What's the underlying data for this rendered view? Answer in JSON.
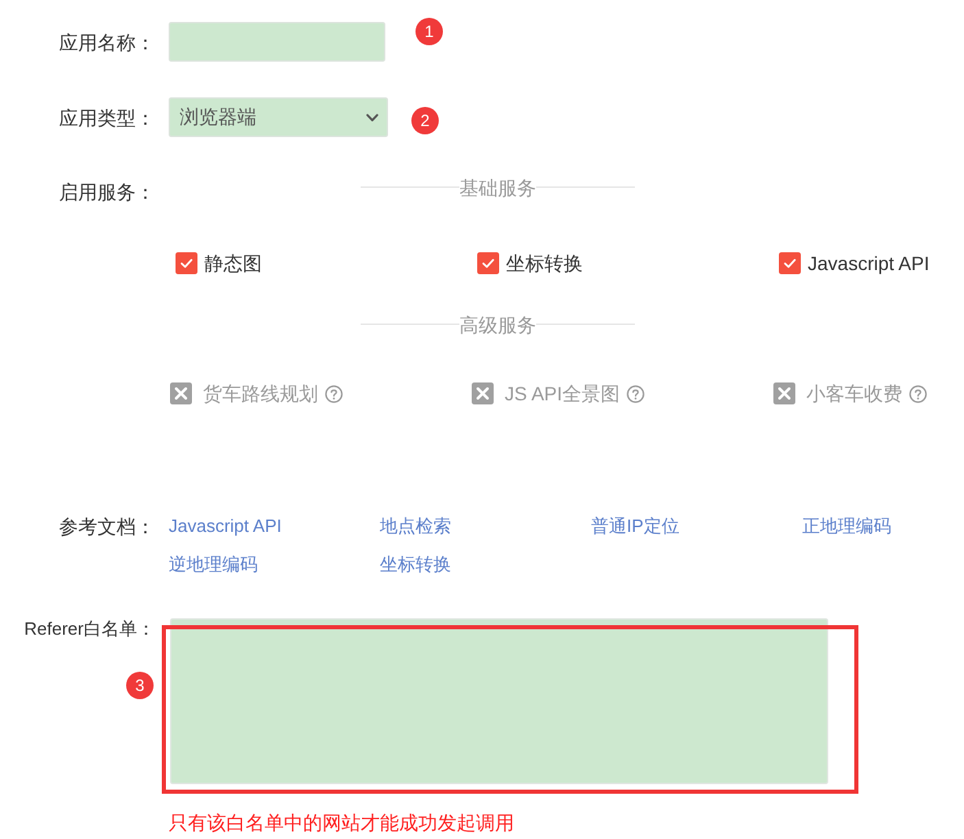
{
  "app_name": {
    "label": "应用名称：",
    "badge": "1"
  },
  "app_type": {
    "label": "应用类型：",
    "value": "浏览器端",
    "badge": "2"
  },
  "services": {
    "label": "启用服务：",
    "groups": [
      {
        "title": "基础服务",
        "items": [
          {
            "label": "静态图",
            "checked": true,
            "disabled": false,
            "help": false
          },
          {
            "label": "坐标转换",
            "checked": true,
            "disabled": false,
            "help": false
          },
          {
            "label": "Javascript API",
            "checked": true,
            "disabled": false,
            "help": false
          }
        ]
      },
      {
        "title": "高级服务",
        "items": [
          {
            "label": "货车路线规划",
            "checked": false,
            "disabled": true,
            "help": true
          },
          {
            "label": "JS API全景图",
            "checked": false,
            "disabled": true,
            "help": true
          },
          {
            "label": "小客车收费",
            "checked": false,
            "disabled": true,
            "help": true
          }
        ]
      }
    ]
  },
  "docs": {
    "label": "参考文档：",
    "links": [
      "Javascript API",
      "地点检索",
      "普通IP定位",
      "正地理编码",
      "逆地理编码",
      "坐标转换"
    ]
  },
  "referer": {
    "label": "Referer白名单：",
    "badge": "3",
    "highlighted": true,
    "hint": "只有该白名单中的网站才能成功发起调用"
  }
}
